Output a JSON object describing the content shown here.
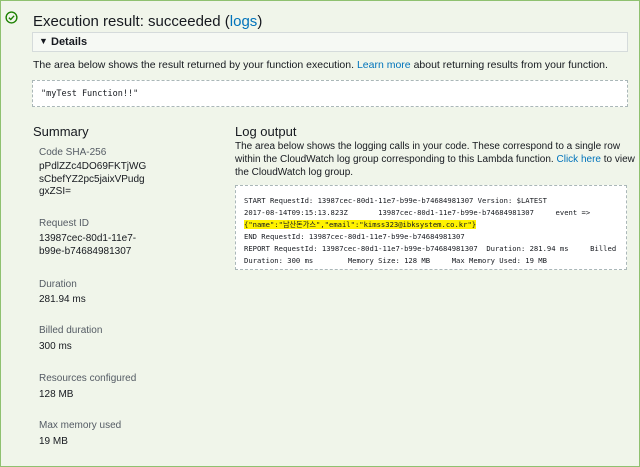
{
  "result": {
    "title_prefix": "Execution result: succeeded (",
    "logs_link": "logs",
    "title_suffix": ")"
  },
  "details": {
    "label": "Details",
    "description_prefix": "The area below shows the result returned by your function execution.",
    "learn_more": "Learn more",
    "description_suffix": "about returning results from your function.",
    "returned_value": "\"myTest Function!!\""
  },
  "summary": {
    "title": "Summary",
    "items": [
      {
        "label": "Code SHA-256",
        "value": "pPdlZZc4DO69FKTjWG sCbefYZ2pc5jaixVPudg gxZSI="
      },
      {
        "label": "Request ID",
        "value": "13987cec-80d1-11e7-b99e-b74684981307"
      },
      {
        "label": "Duration",
        "value": "281.94 ms"
      },
      {
        "label": "Billed duration",
        "value": "300 ms"
      },
      {
        "label": "Resources configured",
        "value": "128 MB"
      },
      {
        "label": "Max memory used",
        "value": "19 MB"
      }
    ]
  },
  "log": {
    "title": "Log output",
    "description_prefix": "The area below shows the logging calls in your code. These correspond to a single row within the CloudWatch log group corresponding to this Lambda function.",
    "click_here": "Click here",
    "description_suffix": "to view the CloudWatch log group.",
    "lines": [
      "START RequestId: 13987cec-80d1-11e7-b99e-b74684981307 Version: $LATEST",
      "2017-08-14T09:15:13.823Z       13987cec-80d1-11e7-b99e-b74684981307     event =>",
      "{\"name\":\"남산돈가스\",\"email\":\"kimss323@ibksystem.co.kr\"}",
      "END RequestId: 13987cec-80d1-11e7-b99e-b74684981307",
      "REPORT RequestId: 13987cec-80d1-11e7-b99e-b74684981307  Duration: 281.94 ms     Billed",
      "Duration: 300 ms        Memory Size: 128 MB     Max Memory Used: 19 MB"
    ]
  },
  "colors": {
    "success": "#1d8102",
    "link": "#0073bb",
    "highlight": "#fff200"
  }
}
